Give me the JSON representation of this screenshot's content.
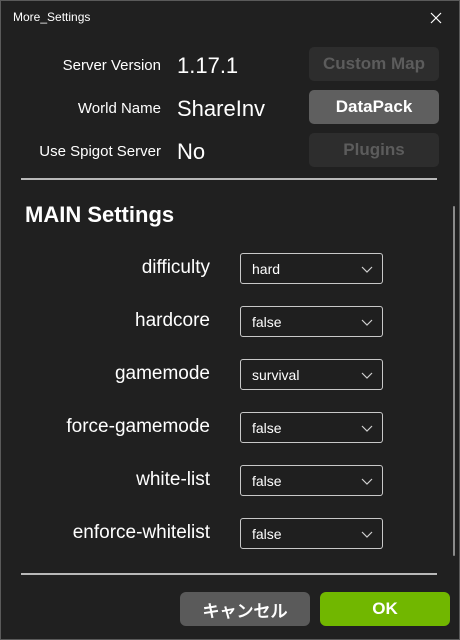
{
  "window": {
    "title": "More_Settings"
  },
  "info": [
    {
      "label": "Server Version",
      "value": "1.17.1"
    },
    {
      "label": "World Name",
      "value": "ShareInv"
    },
    {
      "label": "Use Spigot Server",
      "value": "No"
    }
  ],
  "side_buttons": {
    "custom_map": "Custom Map",
    "datapack": "DataPack",
    "plugins": "Plugins"
  },
  "section": {
    "title": "MAIN Settings"
  },
  "settings": [
    {
      "label": "difficulty",
      "value": "hard"
    },
    {
      "label": "hardcore",
      "value": "false"
    },
    {
      "label": "gamemode",
      "value": "survival"
    },
    {
      "label": "force-gamemode",
      "value": "false"
    },
    {
      "label": "white-list",
      "value": "false"
    },
    {
      "label": "enforce-whitelist",
      "value": "false"
    }
  ],
  "footer": {
    "cancel_label": "キャンセル",
    "ok_label": "OK"
  },
  "colors": {
    "background": "#202020",
    "ok_accent": "#71b700",
    "button_gray": "#5a5a5a"
  },
  "icons": {
    "close": "close-icon",
    "dropdown": "chevron-down-icon"
  }
}
